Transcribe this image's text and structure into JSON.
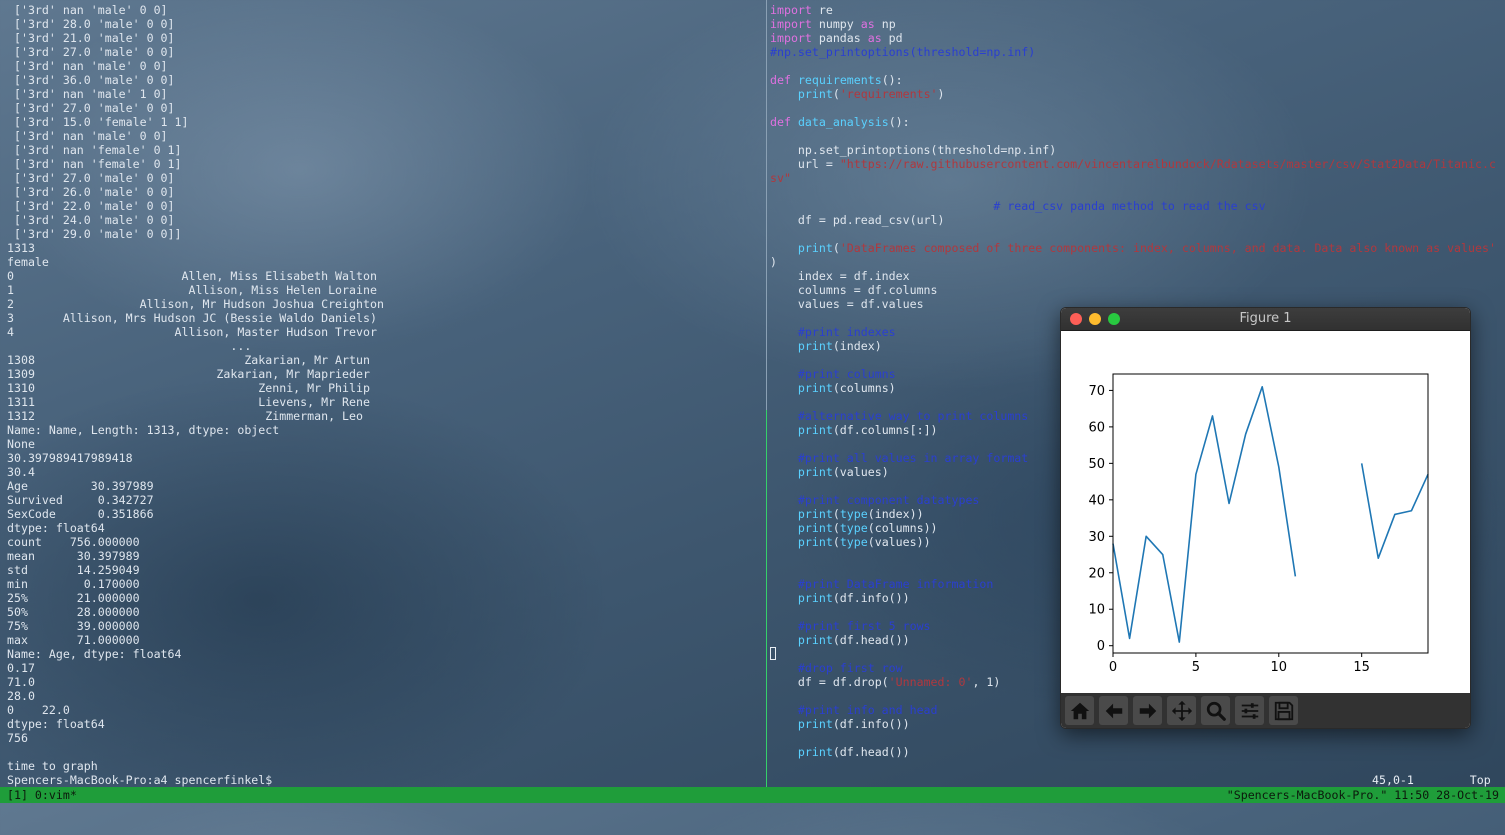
{
  "left_terminal": {
    "lines": [
      " ['3rd' nan 'male' 0 0]",
      " ['3rd' 28.0 'male' 0 0]",
      " ['3rd' 21.0 'male' 0 0]",
      " ['3rd' 27.0 'male' 0 0]",
      " ['3rd' nan 'male' 0 0]",
      " ['3rd' 36.0 'male' 0 0]",
      " ['3rd' nan 'male' 1 0]",
      " ['3rd' 27.0 'male' 0 0]",
      " ['3rd' 15.0 'female' 1 1]",
      " ['3rd' nan 'male' 0 0]",
      " ['3rd' nan 'female' 0 1]",
      " ['3rd' nan 'female' 0 1]",
      " ['3rd' 27.0 'male' 0 0]",
      " ['3rd' 26.0 'male' 0 0]",
      " ['3rd' 22.0 'male' 0 0]",
      " ['3rd' 24.0 'male' 0 0]",
      " ['3rd' 29.0 'male' 0 0]]",
      "1313",
      "female",
      "0                        Allen, Miss Elisabeth Walton",
      "1                         Allison, Miss Helen Loraine",
      "2                  Allison, Mr Hudson Joshua Creighton",
      "3       Allison, Mrs Hudson JC (Bessie Waldo Daniels)",
      "4                       Allison, Master Hudson Trevor",
      "                                ...",
      "1308                              Zakarian, Mr Artun",
      "1309                          Zakarian, Mr Maprieder",
      "1310                                Zenni, Mr Philip",
      "1311                                Lievens, Mr Rene",
      "1312                                 Zimmerman, Leo",
      "Name: Name, Length: 1313, dtype: object",
      "None",
      "30.397989417989418",
      "30.4",
      "Age         30.397989",
      "Survived     0.342727",
      "SexCode      0.351866",
      "dtype: float64",
      "count    756.000000",
      "mean      30.397989",
      "std       14.259049",
      "min        0.170000",
      "25%       21.000000",
      "50%       28.000000",
      "75%       39.000000",
      "max       71.000000",
      "Name: Age, dtype: float64",
      "0.17",
      "71.0",
      "28.0",
      "0    22.0",
      "dtype: float64",
      "756",
      "",
      "time to graph",
      "Spencers-MacBook-Pro:a4 spencerfinkel$"
    ]
  },
  "code_lines": [
    [
      {
        "t": "import",
        "c": "kw"
      },
      {
        "t": " re",
        "c": ""
      }
    ],
    [
      {
        "t": "import",
        "c": "kw"
      },
      {
        "t": " numpy ",
        "c": ""
      },
      {
        "t": "as",
        "c": "kw"
      },
      {
        "t": " np",
        "c": ""
      }
    ],
    [
      {
        "t": "import",
        "c": "kw"
      },
      {
        "t": " pandas ",
        "c": ""
      },
      {
        "t": "as",
        "c": "kw"
      },
      {
        "t": " pd",
        "c": ""
      }
    ],
    [
      {
        "t": "#np.set_printoptions(threshold=np.inf)",
        "c": "cm"
      }
    ],
    [],
    [
      {
        "t": "def",
        "c": "kw"
      },
      {
        "t": " ",
        "c": ""
      },
      {
        "t": "requirements",
        "c": "fn"
      },
      {
        "t": "():",
        "c": ""
      }
    ],
    [
      {
        "t": "    ",
        "c": ""
      },
      {
        "t": "print",
        "c": "fn"
      },
      {
        "t": "(",
        "c": ""
      },
      {
        "t": "'requirements'",
        "c": "str"
      },
      {
        "t": ")",
        "c": ""
      }
    ],
    [],
    [
      {
        "t": "def",
        "c": "kw"
      },
      {
        "t": " ",
        "c": ""
      },
      {
        "t": "data_analysis",
        "c": "fn"
      },
      {
        "t": "():",
        "c": ""
      }
    ],
    [],
    [
      {
        "t": "    np.set_printoptions(threshold=np.inf)",
        "c": ""
      }
    ],
    [
      {
        "t": "    url = ",
        "c": ""
      },
      {
        "t": "\"https://raw.githubusercontent.com/vincentarelbundock/Rdatasets/master/csv/Stat2Data/Titanic.c",
        "c": "str"
      }
    ],
    [
      {
        "t": "sv\"",
        "c": "str"
      }
    ],
    [],
    [
      {
        "t": "                                # read_csv panda method to read the csv",
        "c": "cm"
      }
    ],
    [
      {
        "t": "    df = pd.read_csv(url)",
        "c": ""
      }
    ],
    [],
    [
      {
        "t": "    ",
        "c": ""
      },
      {
        "t": "print",
        "c": "fn"
      },
      {
        "t": "(",
        "c": ""
      },
      {
        "t": "'DataFrames composed of three components: index, columns, and data. Data also known as values'",
        "c": "str"
      }
    ],
    [
      {
        "t": ")",
        "c": ""
      }
    ],
    [
      {
        "t": "    index = df.index",
        "c": ""
      }
    ],
    [
      {
        "t": "    columns = df.columns",
        "c": ""
      }
    ],
    [
      {
        "t": "    values = df.values",
        "c": ""
      }
    ],
    [],
    [
      {
        "t": "    ",
        "c": ""
      },
      {
        "t": "#print indexes",
        "c": "cm"
      }
    ],
    [
      {
        "t": "    ",
        "c": ""
      },
      {
        "t": "print",
        "c": "fn"
      },
      {
        "t": "(index)",
        "c": ""
      }
    ],
    [],
    [
      {
        "t": "    ",
        "c": ""
      },
      {
        "t": "#print columns",
        "c": "cm"
      }
    ],
    [
      {
        "t": "    ",
        "c": ""
      },
      {
        "t": "print",
        "c": "fn"
      },
      {
        "t": "(columns)",
        "c": ""
      }
    ],
    [],
    [
      {
        "t": "    ",
        "c": ""
      },
      {
        "t": "#alternative way to print columns",
        "c": "cm"
      }
    ],
    [
      {
        "t": "    ",
        "c": ""
      },
      {
        "t": "print",
        "c": "fn"
      },
      {
        "t": "(df.columns[:])",
        "c": ""
      }
    ],
    [],
    [
      {
        "t": "    ",
        "c": ""
      },
      {
        "t": "#print all values in array format",
        "c": "cm"
      }
    ],
    [
      {
        "t": "    ",
        "c": ""
      },
      {
        "t": "print",
        "c": "fn"
      },
      {
        "t": "(values)",
        "c": ""
      }
    ],
    [],
    [
      {
        "t": "    ",
        "c": ""
      },
      {
        "t": "#print component datatypes",
        "c": "cm"
      }
    ],
    [
      {
        "t": "    ",
        "c": ""
      },
      {
        "t": "print",
        "c": "fn"
      },
      {
        "t": "(",
        "c": ""
      },
      {
        "t": "type",
        "c": "fn"
      },
      {
        "t": "(index))",
        "c": ""
      }
    ],
    [
      {
        "t": "    ",
        "c": ""
      },
      {
        "t": "print",
        "c": "fn"
      },
      {
        "t": "(",
        "c": ""
      },
      {
        "t": "type",
        "c": "fn"
      },
      {
        "t": "(columns))",
        "c": ""
      }
    ],
    [
      {
        "t": "    ",
        "c": ""
      },
      {
        "t": "print",
        "c": "fn"
      },
      {
        "t": "(",
        "c": ""
      },
      {
        "t": "type",
        "c": "fn"
      },
      {
        "t": "(values))",
        "c": ""
      }
    ],
    [],
    [],
    [
      {
        "t": "    ",
        "c": ""
      },
      {
        "t": "#print DataFrame information",
        "c": "cm"
      }
    ],
    [
      {
        "t": "    ",
        "c": ""
      },
      {
        "t": "print",
        "c": "fn"
      },
      {
        "t": "(df.info())",
        "c": ""
      }
    ],
    [],
    [
      {
        "t": "    ",
        "c": ""
      },
      {
        "t": "#print first 5 rows",
        "c": "cm"
      }
    ],
    [
      {
        "t": "    ",
        "c": ""
      },
      {
        "t": "print",
        "c": "fn"
      },
      {
        "t": "(df.head())",
        "c": ""
      }
    ],
    [],
    [
      {
        "t": "    ",
        "c": ""
      },
      {
        "t": "#drop first row",
        "c": "cm"
      }
    ],
    [
      {
        "t": "    df = df.drop(",
        "c": ""
      },
      {
        "t": "'Unnamed: 0'",
        "c": "str"
      },
      {
        "t": ", 1)",
        "c": ""
      }
    ],
    [],
    [
      {
        "t": "    ",
        "c": ""
      },
      {
        "t": "#print info and head",
        "c": "cm"
      }
    ],
    [
      {
        "t": "    ",
        "c": ""
      },
      {
        "t": "print",
        "c": "fn"
      },
      {
        "t": "(df.info())",
        "c": ""
      }
    ],
    [],
    [
      {
        "t": "    ",
        "c": ""
      },
      {
        "t": "print",
        "c": "fn"
      },
      {
        "t": "(df.head())",
        "c": ""
      }
    ]
  ],
  "vim": {
    "position": "45,0-1",
    "scroll": "Top"
  },
  "tmux": {
    "left": "[1] 0:vim*",
    "right": "\"Spencers-MacBook-Pro.\" 11:50 28-Oct-19"
  },
  "figure": {
    "title": "Figure 1",
    "toolbar_icons": [
      "home-icon",
      "back-arrow-icon",
      "forward-arrow-icon",
      "pan-icon",
      "zoom-icon",
      "configure-subplots-icon",
      "save-icon"
    ]
  },
  "colors": {
    "line": "#1f77b4",
    "status_bar": "#1f9d3a"
  },
  "chart_data": {
    "type": "line",
    "x": [
      0,
      1,
      2,
      3,
      4,
      5,
      6,
      7,
      8,
      9,
      10,
      11,
      12,
      13,
      14,
      15,
      16,
      17,
      18,
      19
    ],
    "values": [
      28,
      2,
      30,
      25,
      1,
      47,
      63,
      39,
      58,
      71,
      49,
      19,
      null,
      null,
      null,
      50,
      24,
      36,
      37,
      47
    ],
    "xlim": [
      0,
      19
    ],
    "ylim": [
      -2,
      74.5
    ],
    "xticks": [
      "0",
      "5",
      "10",
      "15"
    ],
    "xtick_values": [
      0,
      5,
      10,
      15
    ],
    "yticks": [
      "0",
      "10",
      "20",
      "30",
      "40",
      "50",
      "60",
      "70"
    ],
    "ytick_values": [
      0,
      10,
      20,
      30,
      40,
      50,
      60,
      70
    ],
    "title": "",
    "xlabel": "",
    "ylabel": ""
  }
}
